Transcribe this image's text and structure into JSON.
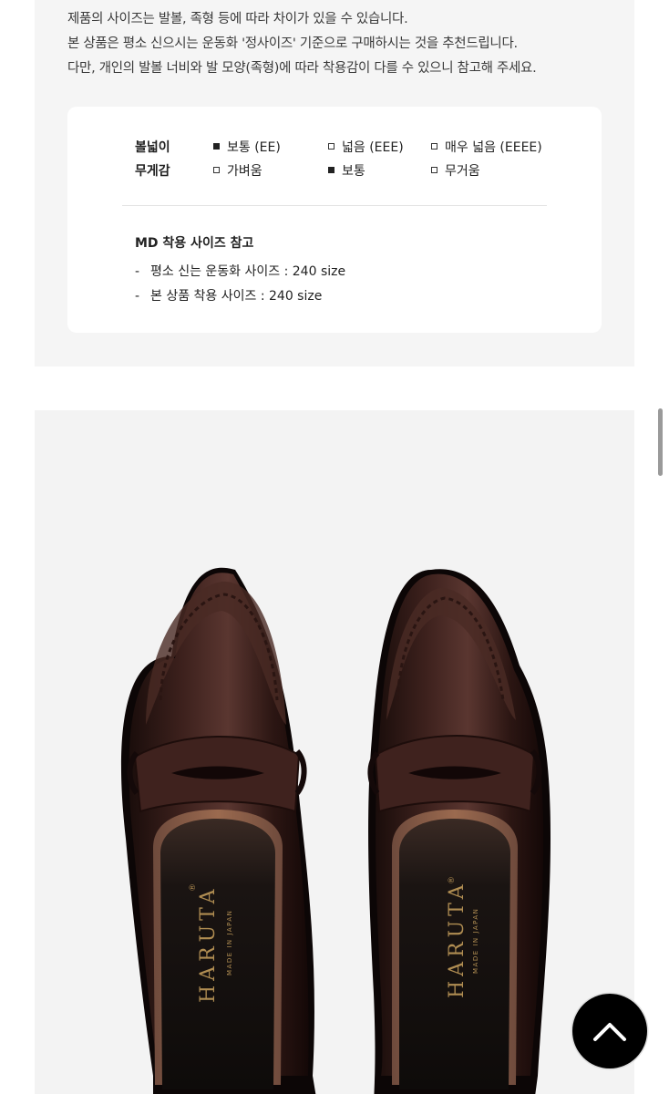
{
  "notice_lines": [
    "제품의 사이즈는 발볼, 족형 등에 따라 차이가 있을 수 있습니다.",
    "본 상품은 평소 신으시는 운동화 '정사이즈' 기준으로 구매하시는 것을 추천드립니다.",
    "다만, 개인의 발볼 너비와 발 모양(족형)에 따라 착용감이 다를 수 있으니 참고해 주세요."
  ],
  "spec": {
    "width": {
      "label": "볼넓이",
      "options": [
        {
          "text": "보통 (EE)",
          "selected": true
        },
        {
          "text": "넓음 (EEE)",
          "selected": false
        },
        {
          "text": "매우 넓음 (EEEE)",
          "selected": false
        }
      ]
    },
    "weight": {
      "label": "무게감",
      "options": [
        {
          "text": "가벼움",
          "selected": false
        },
        {
          "text": "보통",
          "selected": true
        },
        {
          "text": "무거움",
          "selected": false
        }
      ]
    }
  },
  "md_fit": {
    "title": "MD 착용 사이즈 참고",
    "items": [
      {
        "dash": "-",
        "text": "평소 신는 운동화 사이즈 : 240 size"
      },
      {
        "dash": "-",
        "text": "본 상품 착용 사이즈 : 240 size"
      }
    ]
  },
  "product_image": {
    "brand": "HARUTA",
    "insole_text": "MADE IN JAPAN",
    "registered_mark": "®"
  },
  "colors": {
    "panel_bg": "#f5f5f5",
    "leather": "#3a1f1c",
    "top_button_bg": "#000000"
  },
  "icons": {
    "top_button": "chevron-up-icon"
  }
}
